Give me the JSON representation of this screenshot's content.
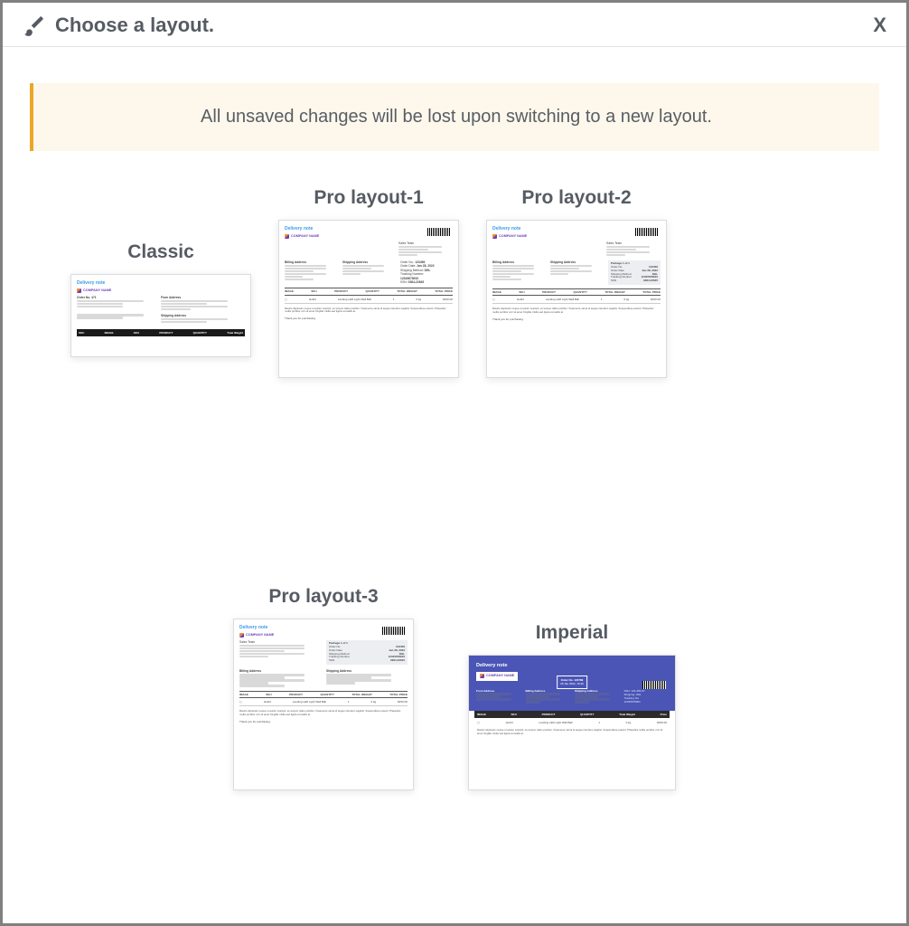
{
  "header": {
    "title": "Choose a layout.",
    "close_label": "X"
  },
  "warning": {
    "text": "All unsaved changes will be lost upon switching to a new layout."
  },
  "layouts": {
    "classic": {
      "label": "Classic"
    },
    "pro1": {
      "label": "Pro layout-1"
    },
    "pro2": {
      "label": "Pro layout-2"
    },
    "pro3": {
      "label": "Pro layout-3"
    },
    "imperial": {
      "label": "Imperial"
    }
  },
  "doc": {
    "title": "Delivery note",
    "company": "COMPANY NAME",
    "billing_label": "Billing Address",
    "shipping_label": "Shipping Address",
    "from_label": "From Address",
    "package": {
      "heading": "Package 1 of 1",
      "order_no_label": "Order No.",
      "order_no": "123456",
      "order_date_label": "Order Date",
      "order_date": "Jan 28, 2022",
      "ship_via_label": "Shipping Method",
      "ship_via": "DHL",
      "tracking_label": "Tracking Number",
      "tracking": "12345678910",
      "ssn_label": "SSN",
      "ssn": "0384-22645"
    },
    "table": {
      "image": "IMAGE",
      "sku": "SKU",
      "product": "PRODUCT",
      "quantity": "QUANTITY",
      "total_weight": "TOTAL WEIGHT",
      "total_price": "TOTAL PRICE",
      "price": "Price",
      "weight": "Total Weight"
    },
    "sample": {
      "sku": "sku04",
      "product": "Landing LED Light Wall Ball",
      "qty": "1",
      "wt": "0 kg",
      "price": "$150.00"
    },
    "footer_note": "Mauris dignissim neque ut auctor suscipit, eu tempor tellus porttitor. Vivamente varna id augue interdum sagittis. Suspendisse potenti. Phasellus mollis porttitor orci sit amet fringilla. Nulla sed ligula convallis at.",
    "thanks": "Thank you for purchasing.",
    "imperial_order_title": "Order No. 123789",
    "imperial_order_date": "28 Jan 2022, 10:40"
  }
}
